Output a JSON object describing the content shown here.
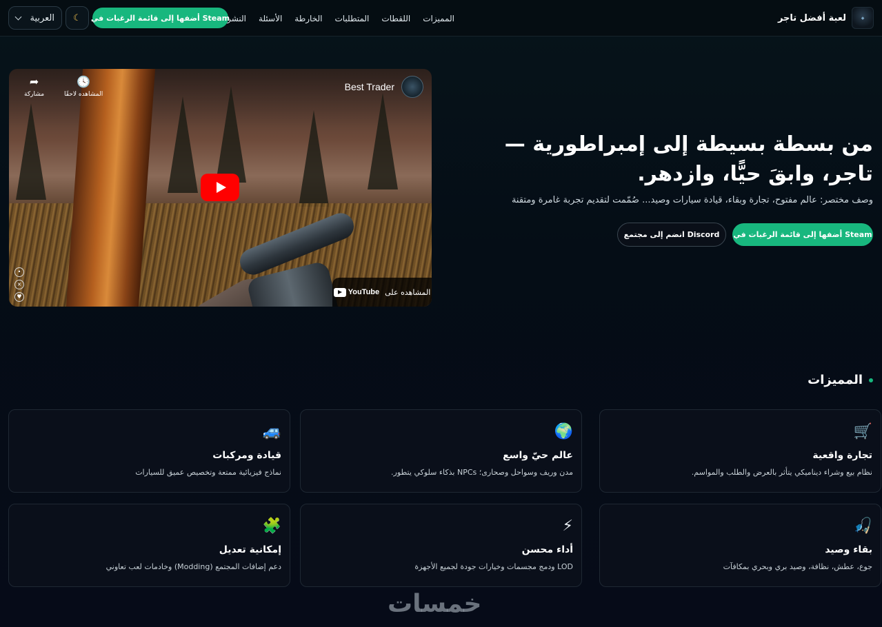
{
  "nav": {
    "brand_name": "لعبة أفضل تاجر",
    "brand_logo_icon": "game-logo",
    "links": [
      "المميزات",
      "اللقطات",
      "المتطلبات",
      "الخارطة",
      "الأسئلة",
      "النشرة"
    ],
    "cta_label": "أضفها إلى قائمة الرغبات في Steam",
    "theme_icon": "moon-icon",
    "language": "العربية"
  },
  "video": {
    "channel_title": "Best Trader",
    "watch_later_label": "المشاهده لاحقًا",
    "share_label": "مشاركة",
    "watch_on_label": "المشاهده على",
    "youtube_word": "YouTube"
  },
  "hero": {
    "title": "من بسطة بسيطة إلى إمبراطورية — تاجر، وابقَ حيًّا، وازدهر.",
    "description": "وصف مختصر: عالم مفتوح، تجارة وبقاء، قيادة سيارات وصيد... صُمّمت لتقديم تجربة غامرة ومتقنة",
    "steam_button": "أضفها إلى قائمة الرغبات في Steam",
    "discord_button": "انضم إلى مجتمع Discord"
  },
  "features": {
    "title": "المميزات",
    "cards": [
      {
        "icon": "🛒",
        "title": "تجارة واقعية",
        "desc": "نظام بيع وشراء ديناميكي يتأثر بالعرض والطلب والمواسم."
      },
      {
        "icon": "🌍",
        "title": "عالم حيّ واسع",
        "desc": "مدن وريف وسواحل وصحارى؛ NPCs بذكاء سلوكي يتطور."
      },
      {
        "icon": "🚙",
        "title": "قيادة ومركبات",
        "desc": "نماذج فيزيائية ممتعة وتخصيص عميق للسيارات"
      },
      {
        "icon": "🎣",
        "title": "بقاء وصيد",
        "desc": "جوع، عطش، نظافة، وصيد بري وبحري بمكافآت"
      },
      {
        "icon": "⚡",
        "title": "أداء محسن",
        "desc": "LOD ودمج مجسمات وخيارات جودة لجميع الأجهزة"
      },
      {
        "icon": "🧩",
        "title": "إمكانية تعديل",
        "desc": "دعم إضافات المجتمع (Modding) وخادمات لعب تعاوني"
      }
    ]
  },
  "watermark": "خمسات",
  "colors": {
    "accent": "#18b77e",
    "background": "#050d16",
    "card": "#0a0f1a"
  }
}
